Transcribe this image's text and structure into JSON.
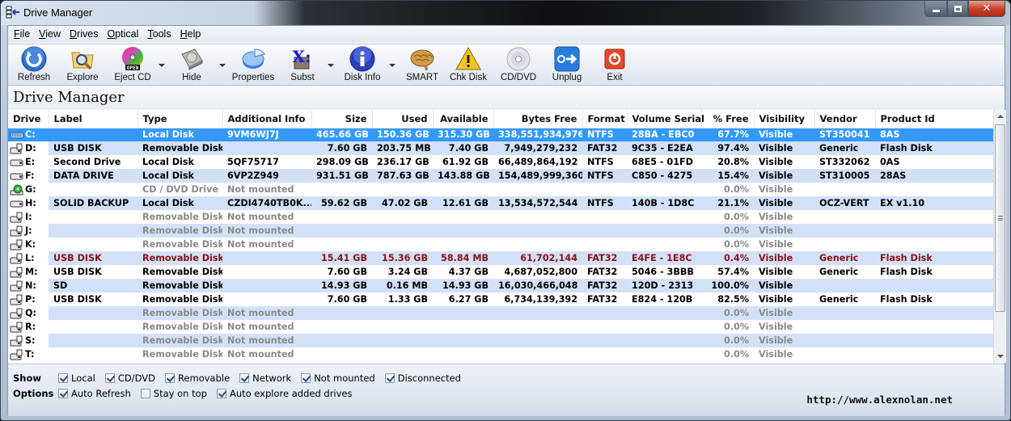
{
  "window": {
    "title": "Drive Manager"
  },
  "menu": [
    "File",
    "View",
    "Drives",
    "Optical",
    "Tools",
    "Help"
  ],
  "toolbar": [
    {
      "label": "Refresh",
      "icon": "refresh-icon",
      "dropdown": false
    },
    {
      "label": "Explore",
      "icon": "explore-folder-icon",
      "dropdown": false
    },
    {
      "label": "Eject CD",
      "icon": "eject-cd-icon",
      "dropdown": true
    },
    {
      "label": "Hide",
      "icon": "hide-drive-icon",
      "dropdown": true
    },
    {
      "label": "Properties",
      "icon": "properties-pie-icon",
      "dropdown": false
    },
    {
      "label": "Subst",
      "icon": "subst-icon",
      "dropdown": true
    },
    {
      "label": "Disk Info",
      "icon": "disk-info-icon",
      "dropdown": true
    },
    {
      "label": "SMART",
      "icon": "smart-brain-icon",
      "dropdown": false
    },
    {
      "label": "Chk Disk",
      "icon": "chkdisk-warning-icon",
      "dropdown": false
    },
    {
      "label": "CD/DVD",
      "icon": "cd-dvd-icon",
      "dropdown": false
    },
    {
      "label": "Unplug",
      "icon": "unplug-icon",
      "dropdown": false
    },
    {
      "label": "Exit",
      "icon": "exit-icon",
      "dropdown": false
    }
  ],
  "heading": "Drive Manager",
  "table": {
    "columns": [
      "Drive",
      "Label",
      "Type",
      "Additional Info",
      "Size",
      "Used",
      "Available",
      "Bytes Free",
      "Format",
      "Volume Serial",
      "% Free",
      "Visibility",
      "Vendor",
      "Product Id"
    ],
    "rows": [
      {
        "state": "sel",
        "icon": "keyboard-drive",
        "cells": [
          "C:",
          "",
          "Local Disk",
          "9VM6WJ7J",
          "465.66 GB",
          "150.36 GB",
          "315.30 GB",
          "338,551,934,976",
          "NTFS",
          "28BA - EBC0",
          "67.7%",
          "Visible",
          "ST350041",
          "8AS"
        ]
      },
      {
        "state": "",
        "icon": "removable",
        "cells": [
          "D:",
          "USB DISK",
          "Removable Disk",
          "",
          "7.60 GB",
          "203.75 MB",
          "7.40 GB",
          "7,949,279,232",
          "FAT32",
          "9C35 - E2EA",
          "97.4%",
          "Visible",
          "Generic",
          "Flash Disk"
        ]
      },
      {
        "state": "",
        "icon": "hdd",
        "cells": [
          "E:",
          "Second Drive",
          "Local Disk",
          "5QF75717",
          "298.09 GB",
          "236.17 GB",
          "61.92 GB",
          "66,489,864,192",
          "NTFS",
          "68E5 - 01FD",
          "20.8%",
          "Visible",
          "ST332062",
          "0AS"
        ]
      },
      {
        "state": "",
        "icon": "hdd",
        "cells": [
          "F:",
          "DATA DRIVE",
          "Local Disk",
          "6VP2Z949",
          "931.51 GB",
          "787.63 GB",
          "143.88 GB",
          "154,489,999,360",
          "NTFS",
          "C850 - 4275",
          "15.4%",
          "Visible",
          "ST310005",
          "28AS"
        ]
      },
      {
        "state": "dim",
        "icon": "cdrom",
        "cells": [
          "G:",
          "",
          "CD / DVD Drive",
          "Not mounted",
          "",
          "",
          "",
          "",
          "",
          "",
          "0.0%",
          "Visible",
          "",
          ""
        ]
      },
      {
        "state": "",
        "icon": "hdd",
        "cells": [
          "H:",
          "SOLID BACKUP",
          "Local Disk",
          "CZDI4740TB0K...",
          "59.62 GB",
          "47.02 GB",
          "12.61 GB",
          "13,534,572,544",
          "NTFS",
          "140B - 1D8C",
          "21.1%",
          "Visible",
          "OCZ-VERT",
          "EX v1.10"
        ]
      },
      {
        "state": "dim",
        "icon": "removable",
        "cells": [
          "I:",
          "",
          "Removable Disk",
          "Not mounted",
          "",
          "",
          "",
          "",
          "",
          "",
          "0.0%",
          "Visible",
          "",
          ""
        ]
      },
      {
        "state": "dim",
        "icon": "removable",
        "cells": [
          "J:",
          "",
          "Removable Disk",
          "Not mounted",
          "",
          "",
          "",
          "",
          "",
          "",
          "0.0%",
          "Visible",
          "",
          ""
        ]
      },
      {
        "state": "dim",
        "icon": "removable",
        "cells": [
          "K:",
          "",
          "Removable Disk",
          "Not mounted",
          "",
          "",
          "",
          "",
          "",
          "",
          "0.0%",
          "Visible",
          "",
          ""
        ]
      },
      {
        "state": "warn",
        "icon": "removable",
        "cells": [
          "L:",
          "USB DISK",
          "Removable Disk",
          "",
          "15.41 GB",
          "15.36 GB",
          "58.84 MB",
          "61,702,144",
          "FAT32",
          "E4FE - 1E8C",
          "0.4%",
          "Visible",
          "Generic",
          "Flash Disk"
        ]
      },
      {
        "state": "",
        "icon": "removable",
        "cells": [
          "M:",
          "USB DISK",
          "Removable Disk",
          "",
          "7.60 GB",
          "3.24 GB",
          "4.37 GB",
          "4,687,052,800",
          "FAT32",
          "5046 - 3BBB",
          "57.4%",
          "Visible",
          "Generic",
          "Flash Disk"
        ]
      },
      {
        "state": "",
        "icon": "removable",
        "cells": [
          "N:",
          "SD",
          "Removable Disk",
          "",
          "14.93 GB",
          "0.16 MB",
          "14.93 GB",
          "16,030,466,048",
          "FAT32",
          "120D - 2313",
          "100.0%",
          "Visible",
          "",
          ""
        ]
      },
      {
        "state": "",
        "icon": "removable",
        "cells": [
          "P:",
          "USB DISK",
          "Removable Disk",
          "",
          "7.60 GB",
          "1.33 GB",
          "6.27 GB",
          "6,734,139,392",
          "FAT32",
          "E824 - 120B",
          "82.5%",
          "Visible",
          "Generic",
          "Flash Disk"
        ]
      },
      {
        "state": "dim",
        "icon": "removable",
        "cells": [
          "Q:",
          "",
          "Removable Disk",
          "Not mounted",
          "",
          "",
          "",
          "",
          "",
          "",
          "0.0%",
          "Visible",
          "",
          ""
        ]
      },
      {
        "state": "dim",
        "icon": "removable",
        "cells": [
          "R:",
          "",
          "Removable Disk",
          "Not mounted",
          "",
          "",
          "",
          "",
          "",
          "",
          "0.0%",
          "Visible",
          "",
          ""
        ]
      },
      {
        "state": "dim",
        "icon": "removable",
        "cells": [
          "S:",
          "",
          "Removable Disk",
          "Not mounted",
          "",
          "",
          "",
          "",
          "",
          "",
          "0.0%",
          "Visible",
          "",
          ""
        ]
      },
      {
        "state": "dim",
        "icon": "removable",
        "cells": [
          "T:",
          "",
          "Removable Disk",
          "Not mounted",
          "",
          "",
          "",
          "",
          "",
          "",
          "0.0%",
          "Visible",
          "",
          ""
        ]
      }
    ]
  },
  "show": {
    "label": "Show",
    "options": [
      {
        "label": "Local",
        "checked": true
      },
      {
        "label": "CD/DVD",
        "checked": true
      },
      {
        "label": "Removable",
        "checked": true
      },
      {
        "label": "Network",
        "checked": true
      },
      {
        "label": "Not mounted",
        "checked": true
      },
      {
        "label": "Disconnected",
        "checked": true
      }
    ]
  },
  "options": {
    "label": "Options",
    "items": [
      {
        "label": "Auto Refresh",
        "checked": true
      },
      {
        "label": "Stay on top",
        "checked": false
      },
      {
        "label": "Auto explore added drives",
        "checked": true
      }
    ]
  },
  "footer_url": "http://www.alexnolan.net",
  "colors": {
    "selection": "#3399ff",
    "alt_row": "#d3e1f8",
    "warning_text": "#8b1010",
    "dim_text": "#8a8a8a"
  }
}
